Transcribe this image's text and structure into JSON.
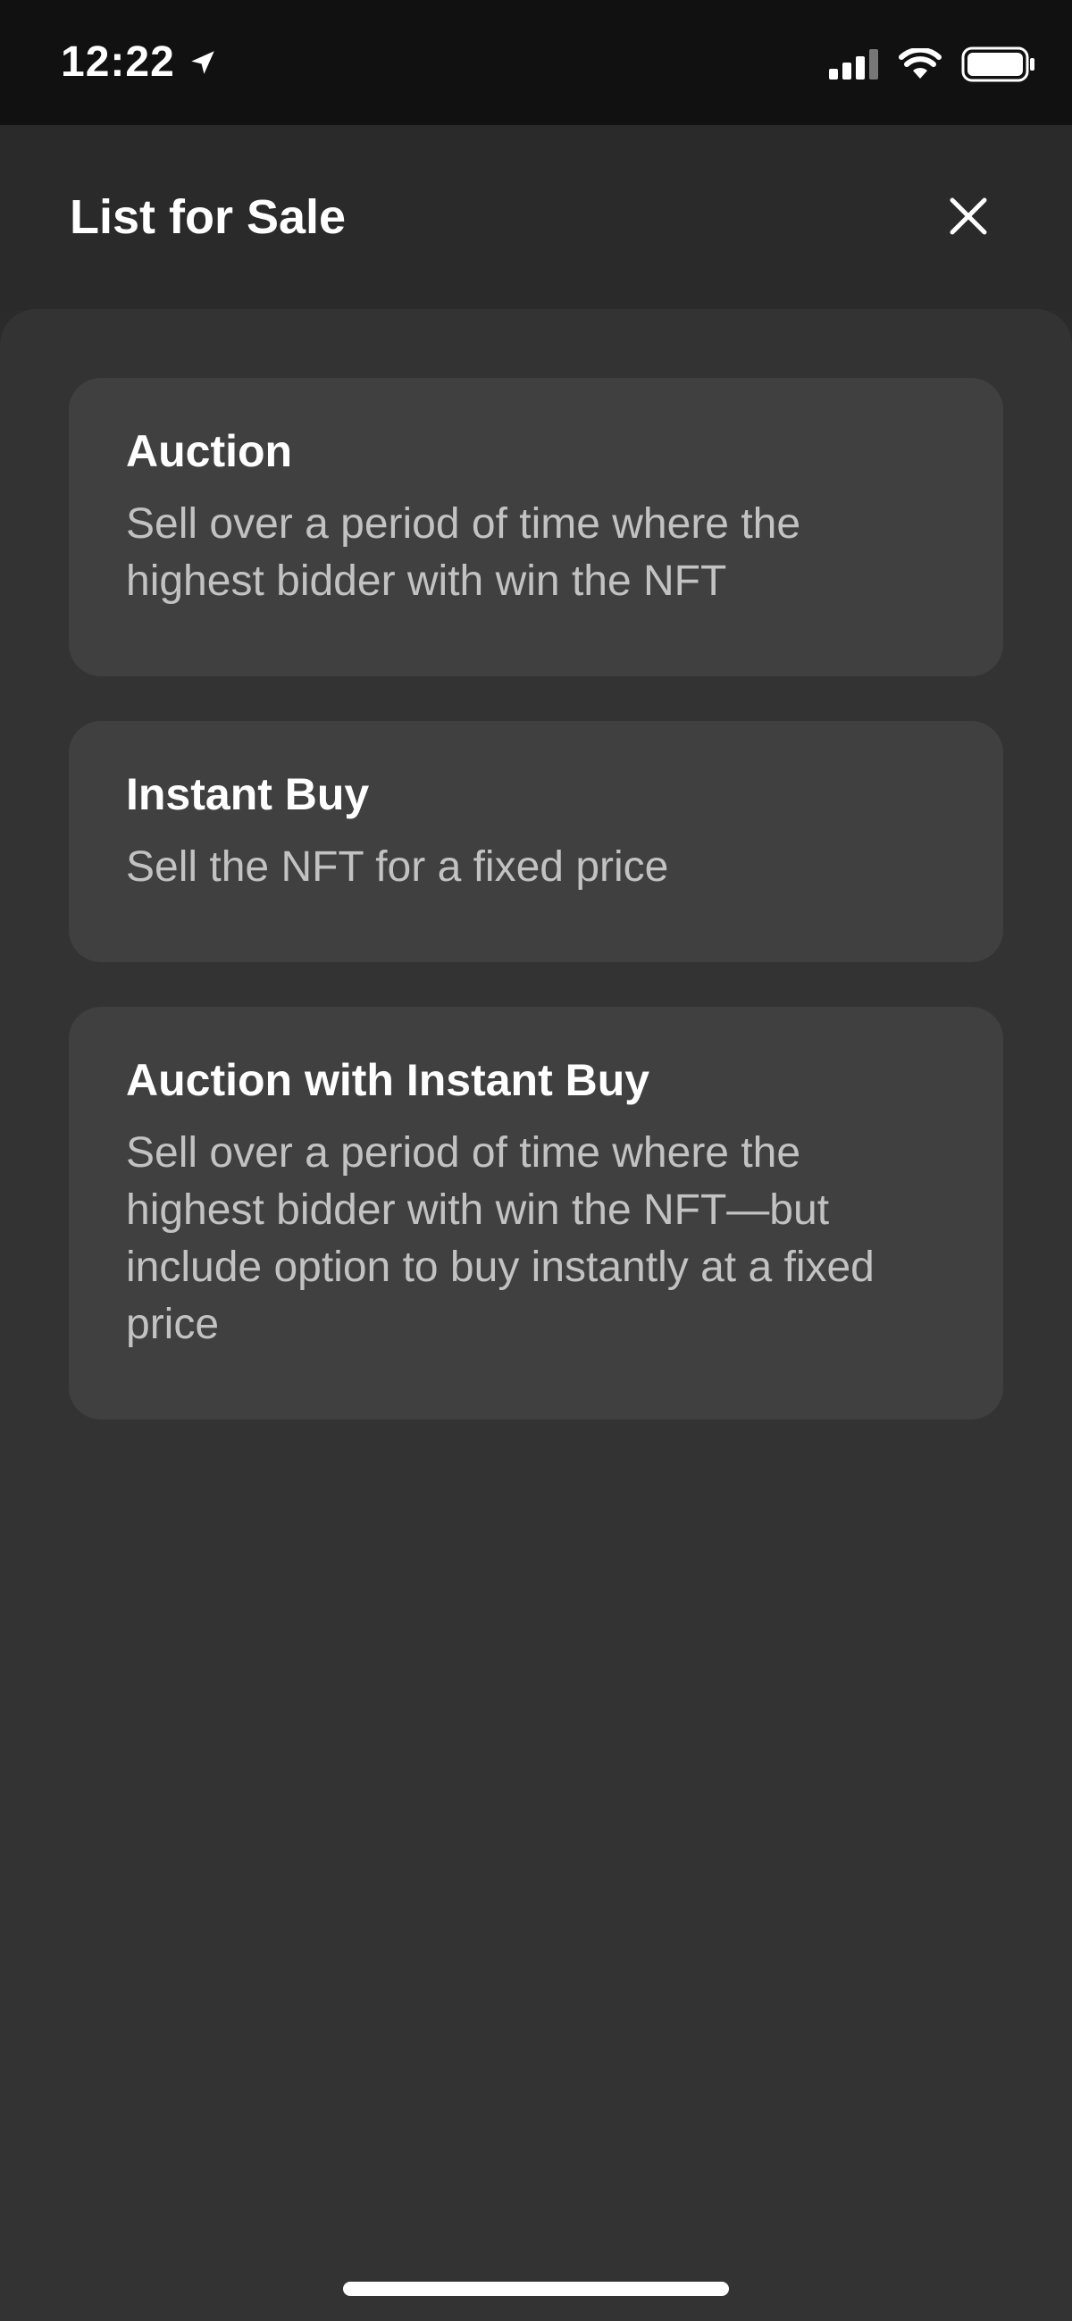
{
  "status_bar": {
    "time": "12:22",
    "location_icon": "location-arrow-icon",
    "signal_icon": "cellular-signal-icon",
    "wifi_icon": "wifi-icon",
    "battery_icon": "battery-icon"
  },
  "header": {
    "title": "List for Sale",
    "close_icon": "close-icon"
  },
  "options": [
    {
      "title": "Auction",
      "description": "Sell over a period of time where the highest bidder with win the NFT"
    },
    {
      "title": "Instant Buy",
      "description": "Sell the NFT for a fixed price"
    },
    {
      "title": "Auction with Instant Buy",
      "description": "Sell over a period of time where the highest bidder with win the NFT—but include option to buy instantly at a fixed price"
    }
  ],
  "colors": {
    "status_bar_bg": "#111111",
    "header_bg": "#2a2a2a",
    "sheet_bg": "#333333",
    "card_bg": "#404040",
    "title_text": "#ffffff",
    "description_text": "#c2c2c2"
  }
}
